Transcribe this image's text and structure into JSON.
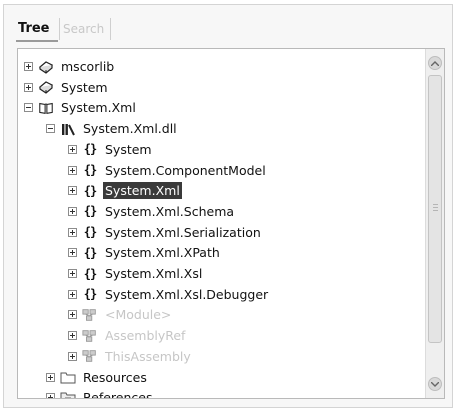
{
  "tabs": [
    {
      "label": "Tree",
      "active": true
    },
    {
      "label": "Search",
      "active": false
    }
  ],
  "tree": {
    "rows": [
      {
        "label": "mscorlib",
        "icon": "assembly-icon",
        "expanded": false,
        "selected": false,
        "faded": false
      },
      {
        "label": "System",
        "icon": "assembly-icon",
        "expanded": false,
        "selected": false,
        "faded": false
      },
      {
        "label": "System.Xml",
        "icon": "library-icon",
        "expanded": true,
        "selected": false,
        "faded": false
      },
      {
        "label": "System.Xml.dll",
        "icon": "module-icon",
        "expanded": true,
        "selected": false,
        "faded": false
      },
      {
        "label": "System",
        "icon": "namespace-icon",
        "expanded": false,
        "selected": false,
        "faded": false
      },
      {
        "label": "System.ComponentModel",
        "icon": "namespace-icon",
        "expanded": false,
        "selected": false,
        "faded": false
      },
      {
        "label": "System.Xml",
        "icon": "namespace-icon",
        "expanded": false,
        "selected": true,
        "faded": false
      },
      {
        "label": "System.Xml.Schema",
        "icon": "namespace-icon",
        "expanded": false,
        "selected": false,
        "faded": false
      },
      {
        "label": "System.Xml.Serialization",
        "icon": "namespace-icon",
        "expanded": false,
        "selected": false,
        "faded": false
      },
      {
        "label": "System.Xml.XPath",
        "icon": "namespace-icon",
        "expanded": false,
        "selected": false,
        "faded": false
      },
      {
        "label": "System.Xml.Xsl",
        "icon": "namespace-icon",
        "expanded": false,
        "selected": false,
        "faded": false
      },
      {
        "label": "System.Xml.Xsl.Debugger",
        "icon": "namespace-icon",
        "expanded": false,
        "selected": false,
        "faded": false
      },
      {
        "label": "<Module>",
        "icon": "class-icon",
        "expanded": false,
        "selected": false,
        "faded": true
      },
      {
        "label": "AssemblyRef",
        "icon": "class-icon",
        "expanded": false,
        "selected": false,
        "faded": true
      },
      {
        "label": "ThisAssembly",
        "icon": "class-icon",
        "expanded": false,
        "selected": false,
        "faded": true
      },
      {
        "label": "Resources",
        "icon": "folder-icon",
        "expanded": false,
        "selected": false,
        "faded": false
      },
      {
        "label": "References",
        "icon": "references-folder-icon",
        "expanded": false,
        "selected": false,
        "faded": false
      }
    ]
  },
  "colors": {
    "selection_bg": "#3a3a3a",
    "selection_fg": "#ffffff",
    "faded_text": "#c6c6c6"
  }
}
